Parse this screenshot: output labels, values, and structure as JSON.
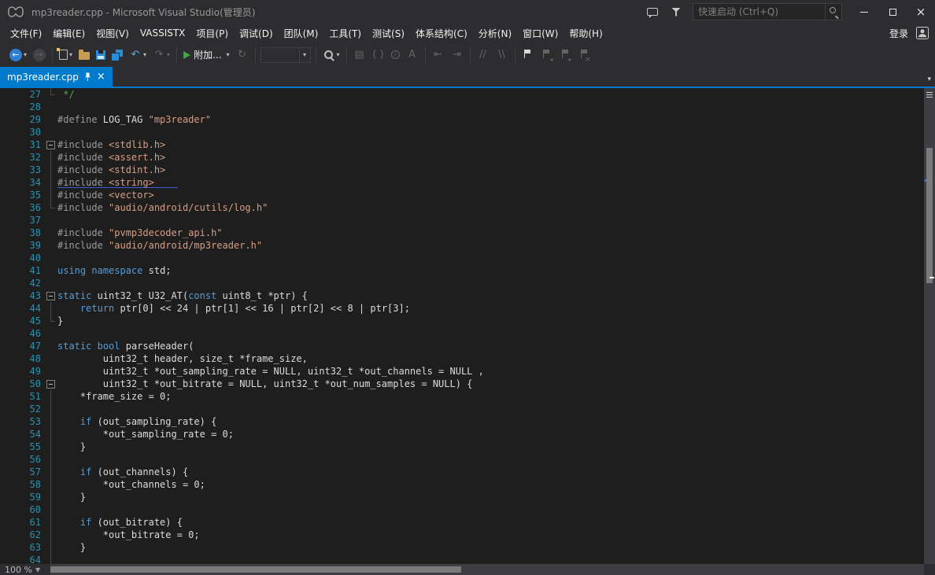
{
  "window": {
    "title": "mp3reader.cpp - Microsoft Visual Studio(管理员)",
    "quick_launch": {
      "placeholder": "快速启动 (Ctrl+Q)"
    }
  },
  "menu": {
    "items": [
      "文件(F)",
      "编辑(E)",
      "视图(V)",
      "VASSISTX",
      "项目(P)",
      "调试(D)",
      "团队(M)",
      "工具(T)",
      "测试(S)",
      "体系结构(C)",
      "分析(N)",
      "窗口(W)",
      "帮助(H)"
    ],
    "sign_in_label": "登录"
  },
  "toolbar": {
    "attach_label": "附加...",
    "configuration_value": "",
    "items": [
      {
        "type": "button",
        "name": "navigate-backward",
        "icon": "nav-back",
        "glyph": "←",
        "dropdown": true
      },
      {
        "type": "button",
        "name": "navigate-forward",
        "icon": "nav-fwd",
        "glyph": "→",
        "enabled": false
      },
      {
        "type": "sep"
      },
      {
        "type": "button",
        "name": "new-file",
        "icon": "page",
        "dropdown": true
      },
      {
        "type": "button",
        "name": "open-file",
        "icon": "folder"
      },
      {
        "type": "button",
        "name": "save",
        "icon": "floppy"
      },
      {
        "type": "button",
        "name": "save-all",
        "icon": "floppy-all"
      },
      {
        "type": "button",
        "name": "undo",
        "icon": "glyph",
        "glyph": "↶",
        "color": "#61AEE0",
        "dropdown": true
      },
      {
        "type": "button",
        "name": "redo",
        "icon": "glyph",
        "glyph": "↷",
        "enabled": false,
        "dropdown": true
      },
      {
        "type": "sep"
      },
      {
        "type": "attach",
        "name": "attach-to-process"
      },
      {
        "type": "button",
        "name": "refresh",
        "icon": "glyph",
        "glyph": "↻",
        "enabled": false
      },
      {
        "type": "sep"
      },
      {
        "type": "combo",
        "name": "configuration-combobox"
      },
      {
        "type": "sep"
      },
      {
        "type": "button",
        "name": "find-in-files",
        "icon": "magnifier",
        "dropdown": true
      },
      {
        "type": "sep"
      },
      {
        "type": "button",
        "name": "display-member-list",
        "icon": "glyph",
        "glyph": "▤",
        "enabled": false
      },
      {
        "type": "button",
        "name": "parameter-info",
        "icon": "glyph",
        "glyph": "( )",
        "enabled": false
      },
      {
        "type": "button",
        "name": "quick-info",
        "icon": "info",
        "glyph": "i",
        "enabled": false
      },
      {
        "type": "button",
        "name": "word-completion",
        "icon": "glyph",
        "glyph": "A",
        "enabled": false
      },
      {
        "type": "sep"
      },
      {
        "type": "button",
        "name": "decrease-indent",
        "icon": "glyph",
        "glyph": "⇤",
        "enabled": false
      },
      {
        "type": "button",
        "name": "increase-indent",
        "icon": "glyph",
        "glyph": "⇥",
        "enabled": false
      },
      {
        "type": "sep"
      },
      {
        "type": "button",
        "name": "comment-selection",
        "icon": "glyph",
        "glyph": "//",
        "enabled": false
      },
      {
        "type": "button",
        "name": "uncomment-selection",
        "icon": "glyph",
        "glyph": "\\\\",
        "enabled": false
      },
      {
        "type": "sep"
      },
      {
        "type": "button",
        "name": "toggle-bookmark",
        "icon": "flag"
      },
      {
        "type": "button",
        "name": "previous-bookmark",
        "icon": "flag-prev",
        "enabled": false
      },
      {
        "type": "button",
        "name": "next-bookmark",
        "icon": "flag-next",
        "enabled": false
      },
      {
        "type": "button",
        "name": "clear-bookmarks",
        "icon": "flag-clear",
        "enabled": false
      }
    ]
  },
  "tab_well": {
    "tabs": [
      {
        "label": "mp3reader.cpp",
        "active": true
      }
    ]
  },
  "editor": {
    "zoom_level": "100 %",
    "lines": [
      {
        "n": 27,
        "f": "end",
        "s": [
          [
            "c",
            " */"
          ]
        ]
      },
      {
        "n": 28,
        "f": null,
        "s": []
      },
      {
        "n": 29,
        "f": null,
        "s": [
          [
            "p",
            "#define"
          ],
          [
            "d",
            " LOG_TAG "
          ],
          [
            "s",
            "\"mp3reader\""
          ]
        ]
      },
      {
        "n": 30,
        "f": null,
        "s": []
      },
      {
        "n": 31,
        "f": "collapse",
        "s": [
          [
            "p",
            "#include"
          ],
          [
            "d",
            " "
          ],
          [
            "s",
            "<stdlib.h>"
          ]
        ]
      },
      {
        "n": 32,
        "f": "line",
        "s": [
          [
            "p",
            "#include"
          ],
          [
            "d",
            " "
          ],
          [
            "s",
            "<assert.h>"
          ]
        ]
      },
      {
        "n": 33,
        "f": "line",
        "s": [
          [
            "p",
            "#include"
          ],
          [
            "d",
            " "
          ],
          [
            "s",
            "<stdint.h>"
          ]
        ]
      },
      {
        "n": 34,
        "f": "line",
        "sq": true,
        "s": [
          [
            "p",
            "#include"
          ],
          [
            "d",
            " "
          ],
          [
            "s",
            "<string>"
          ]
        ]
      },
      {
        "n": 35,
        "f": "line",
        "s": [
          [
            "p",
            "#include"
          ],
          [
            "d",
            " "
          ],
          [
            "s",
            "<vector>"
          ]
        ]
      },
      {
        "n": 36,
        "f": "end",
        "s": [
          [
            "p",
            "#include"
          ],
          [
            "d",
            " "
          ],
          [
            "s",
            "\"audio/android/cutils/log.h\""
          ]
        ]
      },
      {
        "n": 37,
        "f": null,
        "s": []
      },
      {
        "n": 38,
        "f": null,
        "s": [
          [
            "p",
            "#include"
          ],
          [
            "d",
            " "
          ],
          [
            "s",
            "\"pvmp3decoder_api.h\""
          ]
        ]
      },
      {
        "n": 39,
        "f": null,
        "s": [
          [
            "p",
            "#include"
          ],
          [
            "d",
            " "
          ],
          [
            "s",
            "\"audio/android/mp3reader.h\""
          ]
        ]
      },
      {
        "n": 40,
        "f": null,
        "s": []
      },
      {
        "n": 41,
        "f": null,
        "s": [
          [
            "k",
            "using"
          ],
          [
            "d",
            " "
          ],
          [
            "k",
            "namespace"
          ],
          [
            "d",
            " std;"
          ]
        ]
      },
      {
        "n": 42,
        "f": null,
        "s": []
      },
      {
        "n": 43,
        "f": "collapse",
        "s": [
          [
            "k",
            "static"
          ],
          [
            "d",
            " uint32_t U32_AT("
          ],
          [
            "k",
            "const"
          ],
          [
            "d",
            " uint8_t *ptr) {"
          ]
        ]
      },
      {
        "n": 44,
        "f": "line",
        "s": [
          [
            "d",
            "    "
          ],
          [
            "k",
            "return"
          ],
          [
            "d",
            " ptr[0] << 24 | ptr[1] << 16 | ptr[2] << 8 | ptr[3];"
          ]
        ]
      },
      {
        "n": 45,
        "f": "end",
        "s": [
          [
            "d",
            "}"
          ]
        ]
      },
      {
        "n": 46,
        "f": null,
        "s": []
      },
      {
        "n": 47,
        "f": null,
        "s": [
          [
            "k",
            "static"
          ],
          [
            "d",
            " "
          ],
          [
            "k",
            "bool"
          ],
          [
            "d",
            " parseHeader("
          ]
        ]
      },
      {
        "n": 48,
        "f": null,
        "s": [
          [
            "d",
            "        uint32_t header, size_t *frame_size,"
          ]
        ]
      },
      {
        "n": 49,
        "f": null,
        "s": [
          [
            "d",
            "        uint32_t *out_sampling_rate = NULL, uint32_t *out_channels = NULL ,"
          ]
        ]
      },
      {
        "n": 50,
        "f": "collapse",
        "s": [
          [
            "d",
            "        uint32_t *out_bitrate = NULL, uint32_t *out_num_samples = NULL) {"
          ]
        ]
      },
      {
        "n": 51,
        "f": "line",
        "s": [
          [
            "d",
            "    *frame_size = 0;"
          ]
        ]
      },
      {
        "n": 52,
        "f": "line",
        "s": []
      },
      {
        "n": 53,
        "f": "line",
        "s": [
          [
            "d",
            "    "
          ],
          [
            "k",
            "if"
          ],
          [
            "d",
            " (out_sampling_rate) {"
          ]
        ]
      },
      {
        "n": 54,
        "f": "line",
        "s": [
          [
            "d",
            "        *out_sampling_rate = 0;"
          ]
        ]
      },
      {
        "n": 55,
        "f": "line",
        "s": [
          [
            "d",
            "    }"
          ]
        ]
      },
      {
        "n": 56,
        "f": "line",
        "s": []
      },
      {
        "n": 57,
        "f": "line",
        "s": [
          [
            "d",
            "    "
          ],
          [
            "k",
            "if"
          ],
          [
            "d",
            " (out_channels) {"
          ]
        ]
      },
      {
        "n": 58,
        "f": "line",
        "s": [
          [
            "d",
            "        *out_channels = 0;"
          ]
        ]
      },
      {
        "n": 59,
        "f": "line",
        "s": [
          [
            "d",
            "    }"
          ]
        ]
      },
      {
        "n": 60,
        "f": "line",
        "s": []
      },
      {
        "n": 61,
        "f": "line",
        "s": [
          [
            "d",
            "    "
          ],
          [
            "k",
            "if"
          ],
          [
            "d",
            " (out_bitrate) {"
          ]
        ]
      },
      {
        "n": 62,
        "f": "line",
        "s": [
          [
            "d",
            "        *out_bitrate = 0;"
          ]
        ]
      },
      {
        "n": 63,
        "f": "line",
        "s": [
          [
            "d",
            "    }"
          ]
        ]
      },
      {
        "n": 64,
        "f": "line",
        "s": []
      }
    ]
  },
  "colors": {
    "accent": "#007ACC",
    "chrome_bg": "#2D2D30",
    "editor_bg": "#1E1E1E",
    "text": "#DCDCDC",
    "line_number": "#2B91AF",
    "keyword": "#569CD6",
    "string": "#D69D85",
    "comment": "#57A64A",
    "preprocessor": "#9B9B9B",
    "squiggle": "#3B5BDB"
  }
}
